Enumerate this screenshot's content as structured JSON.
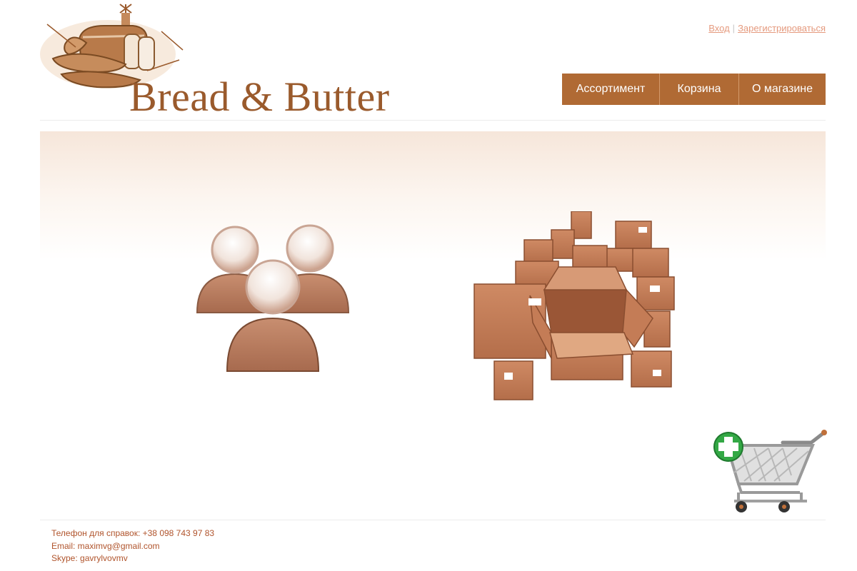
{
  "header": {
    "logo_text": "Bread & Butter",
    "auth": {
      "login": "Вход",
      "separator": "|",
      "register": "Зарегистрироваться"
    },
    "nav": [
      "Ассортимент",
      "Корзина",
      "О магазине"
    ]
  },
  "main": {
    "icons": [
      "users-group-icon",
      "boxes-icon",
      "shopping-cart-add-icon"
    ]
  },
  "footer": {
    "phone": "Телефон для справок: +38 098 743 97 83",
    "email": "Email: maximvg@gmail.com",
    "skype": "Skype: gavrylvovmv"
  },
  "colors": {
    "brand_brown": "#b06a34",
    "logo_brown": "#9a5a2c",
    "link_salmon": "#e59a7e",
    "footer_text": "#b0542c"
  }
}
